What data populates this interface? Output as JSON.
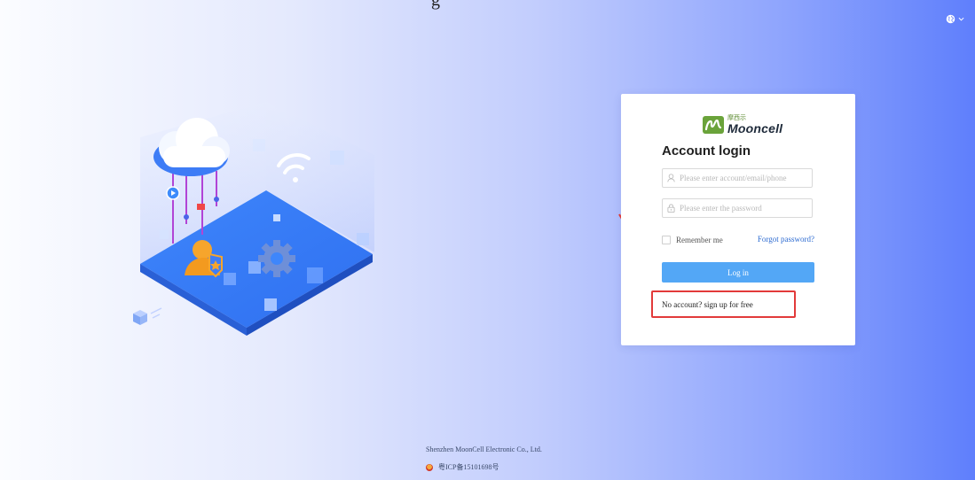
{
  "header": {
    "doc_title_fragment": "g",
    "language_icon": "globe-icon",
    "language_caret": "chevron-down-icon"
  },
  "brand": {
    "cn_name": "摩西示",
    "name": "Mooncell",
    "color": "#5a8a2e"
  },
  "login": {
    "title": "Account login",
    "account_placeholder": "Please enter account/email/phone",
    "password_placeholder": "Please enter the password",
    "remember_label": "Remember me",
    "forgot_label": "Forgot password?",
    "login_label": "Log in",
    "signup_label": "No account? sign up for free",
    "button_color": "#53a7f6",
    "highlight_color": "#e23a3a"
  },
  "footer": {
    "company": "Shenzhen MoonCell Electronic Co., Ltd.",
    "icp": "粤ICP备15101698号"
  }
}
